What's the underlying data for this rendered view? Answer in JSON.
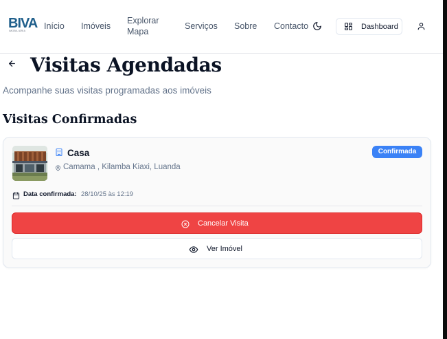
{
  "brand": {
    "name": "BIVA",
    "tagline": "IMOBILIÁRIA"
  },
  "nav": {
    "items": [
      {
        "label": "Início"
      },
      {
        "label": "Imóveis"
      },
      {
        "label": "Explorar Mapa"
      },
      {
        "label": "Serviços"
      },
      {
        "label": "Sobre"
      },
      {
        "label": "Contacto"
      }
    ],
    "theme_icon": "moon-icon",
    "dashboard_label": "Dashboard",
    "dashboard_icon": "layout-grid-icon",
    "user_icon": "user-icon"
  },
  "page": {
    "title": "Visitas Agendadas",
    "subtitle": "Acompanhe suas visitas programadas aos imóveis",
    "back_icon": "arrow-left-icon"
  },
  "section": {
    "title": "Visitas Confirmadas"
  },
  "visit": {
    "property_type": "Casa",
    "location": "Camama , Kilamba Kiaxi, Luanda",
    "status": "Confirmada",
    "date_label": "Data confirmada:",
    "date_value": "28/10/25 às 12:19",
    "cancel_label": "Cancelar Visita",
    "view_label": "Ver Imóvel"
  },
  "colors": {
    "brand": "#1f5f8b",
    "status_badge": "#3b82f6",
    "cancel_button": "#ef4444",
    "text_primary": "#0b1324",
    "text_muted": "#64748b"
  }
}
